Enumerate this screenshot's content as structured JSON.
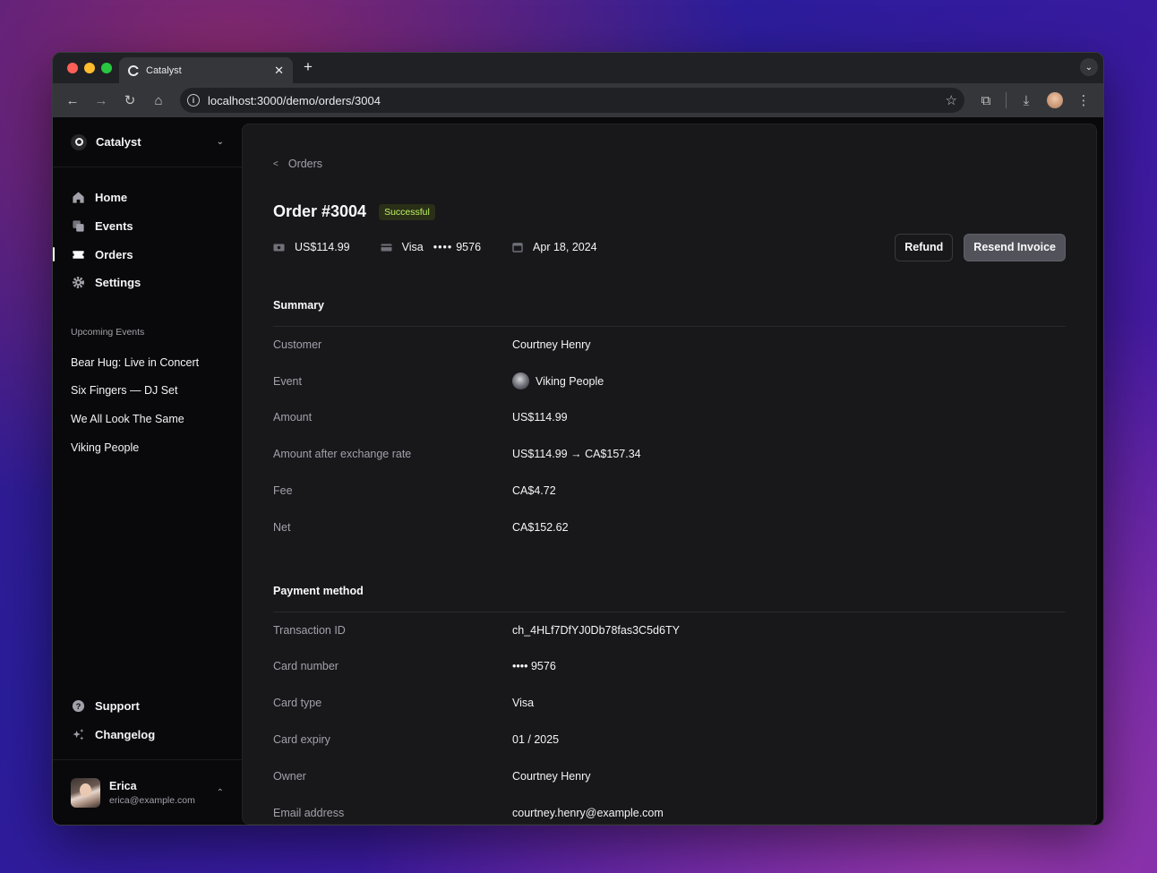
{
  "browser": {
    "tab_title": "Catalyst",
    "url": "localhost:3000/demo/orders/3004",
    "new_tab_symbol": "+"
  },
  "sidebar": {
    "team": "Catalyst",
    "nav": [
      {
        "label": "Home",
        "icon": "home-icon"
      },
      {
        "label": "Events",
        "icon": "squares-icon"
      },
      {
        "label": "Orders",
        "icon": "ticket-icon",
        "current": true
      },
      {
        "label": "Settings",
        "icon": "gear-icon"
      }
    ],
    "upcoming_label": "Upcoming Events",
    "upcoming": [
      {
        "label": "Bear Hug: Live in Concert"
      },
      {
        "label": "Six Fingers — DJ Set"
      },
      {
        "label": "We All Look The Same"
      },
      {
        "label": "Viking People"
      }
    ],
    "bottom": [
      {
        "label": "Support",
        "icon": "question-icon"
      },
      {
        "label": "Changelog",
        "icon": "sparkles-icon"
      }
    ],
    "user": {
      "name": "Erica",
      "email": "erica@example.com"
    }
  },
  "order": {
    "breadcrumb": "Orders",
    "title": "Order #3004",
    "status": "Successful",
    "amount": "US$114.99",
    "card_brand": "Visa",
    "card_dots": "••••",
    "card_last4": "9576",
    "date": "Apr 18, 2024",
    "refund_label": "Refund",
    "resend_label": "Resend Invoice"
  },
  "summary": {
    "title": "Summary",
    "rows": [
      {
        "label": "Customer",
        "value": "Courtney Henry"
      },
      {
        "label": "Event",
        "value": "Viking People"
      },
      {
        "label": "Amount",
        "value": "US$114.99"
      },
      {
        "label": "Amount after exchange rate",
        "value": "US$114.99 → CA$157.34"
      },
      {
        "label": "Fee",
        "value": "CA$4.72"
      },
      {
        "label": "Net",
        "value": "CA$152.62"
      }
    ]
  },
  "payment": {
    "title": "Payment method",
    "rows": [
      {
        "label": "Transaction ID",
        "value": "ch_4HLf7DfYJ0Db78fas3C5d6TY"
      },
      {
        "label": "Card number",
        "value": "•••• 9576"
      },
      {
        "label": "Card type",
        "value": "Visa"
      },
      {
        "label": "Card expiry",
        "value": "01 / 2025"
      },
      {
        "label": "Owner",
        "value": "Courtney Henry"
      },
      {
        "label": "Email address",
        "value": "courtney.henry@example.com"
      }
    ]
  },
  "colors": {
    "badge_text": "#bef264",
    "badge_bg": "#2a2f17",
    "app_bg": "#09090b",
    "panel_bg": "#18181b"
  }
}
